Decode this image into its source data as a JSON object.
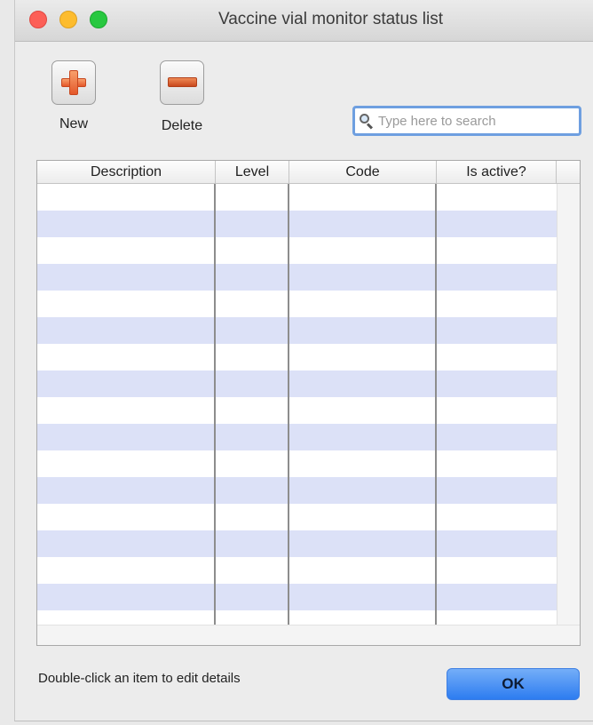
{
  "window": {
    "title": "Vaccine vial monitor status list"
  },
  "toolbar": {
    "new_label": "New",
    "delete_label": "Delete"
  },
  "search": {
    "placeholder": "Type here to search",
    "value": ""
  },
  "table": {
    "columns": [
      "Description",
      "Level",
      "Code",
      "Is active?",
      ""
    ],
    "rows": []
  },
  "footer": {
    "hint": "Double-click an item to edit details",
    "ok_label": "OK"
  },
  "icons": {
    "new": "plus-icon",
    "delete": "minus-icon",
    "search": "search-icon"
  },
  "colors": {
    "row_stripe": "#dce1f7",
    "ok_button": "#2d7cf0",
    "search_focus": "#6e9fe0",
    "new_icon": "#e4582a"
  }
}
